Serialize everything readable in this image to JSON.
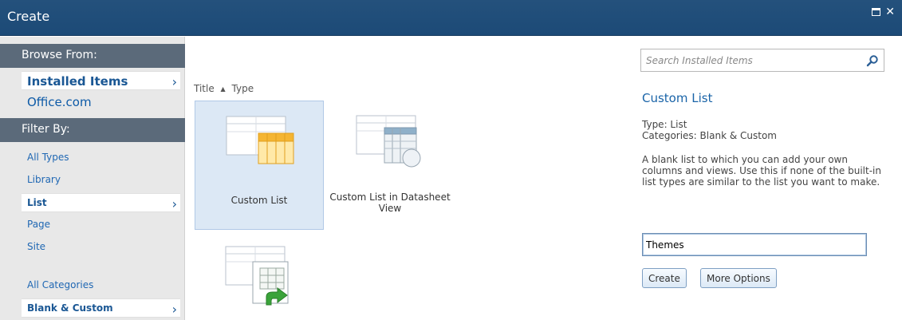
{
  "window": {
    "title": "Create"
  },
  "sidebar": {
    "browse_header": "Browse From:",
    "browse_items": [
      {
        "label": "Installed Items",
        "selected": true
      },
      {
        "label": "Office.com",
        "selected": false
      }
    ],
    "filter_header": "Filter By:",
    "type_items": [
      {
        "label": "All Types",
        "selected": false
      },
      {
        "label": "Library",
        "selected": false
      },
      {
        "label": "List",
        "selected": true
      },
      {
        "label": "Page",
        "selected": false
      },
      {
        "label": "Site",
        "selected": false
      }
    ],
    "category_items": [
      {
        "label": "All Categories",
        "selected": false
      },
      {
        "label": "Blank & Custom",
        "selected": true
      }
    ]
  },
  "sort": {
    "title_label": "Title",
    "type_label": "Type"
  },
  "templates": [
    {
      "label": "Custom List",
      "selected": true,
      "icon": "custom-list-icon"
    },
    {
      "label": "Custom List in Datasheet View",
      "selected": false,
      "icon": "datasheet-list-icon"
    },
    {
      "label": "",
      "selected": false,
      "icon": "import-spreadsheet-icon"
    }
  ],
  "search": {
    "placeholder": "Search Installed Items"
  },
  "detail": {
    "title": "Custom List",
    "type_line": "Type: List",
    "categories_line": "Categories: Blank & Custom",
    "description": "A blank list to which you can add your own columns and views. Use this if none of the built-in list types are similar to the list you want to make."
  },
  "form": {
    "name_value": "Themes",
    "create_label": "Create",
    "more_options_label": "More Options"
  },
  "colors": {
    "titlebar": "#1c4a77",
    "section_header": "#5b6a7a",
    "link": "#1a5794",
    "accent": "#1a64a8"
  }
}
